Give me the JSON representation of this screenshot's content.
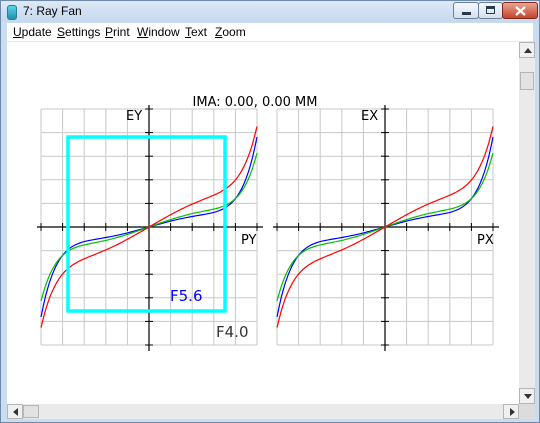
{
  "window": {
    "title": "7: Ray Fan"
  },
  "menu": [
    "Update",
    "Settings",
    "Print",
    "Window",
    "Text",
    "Zoom"
  ],
  "plot": {
    "header": "IMA: 0.00, 0.00 MM",
    "left_panel": {
      "y_label": "EY",
      "x_label": "PY"
    },
    "right_panel": {
      "y_label": "EX",
      "x_label": "PX"
    },
    "annotations": {
      "box_label": "F5.6",
      "f_label": "F4.0"
    }
  },
  "colors": {
    "series_blue": "#0000ff",
    "series_green": "#00c000",
    "series_red": "#ff0000",
    "box": "#00ffff",
    "box_label": "#0000ff",
    "grid": "#c8c8c8"
  },
  "icons": [
    "app-icon",
    "minimize-icon",
    "maximize-icon",
    "close-icon",
    "scroll-up-icon",
    "scroll-down-icon",
    "scroll-left-icon",
    "scroll-right-icon"
  ]
}
